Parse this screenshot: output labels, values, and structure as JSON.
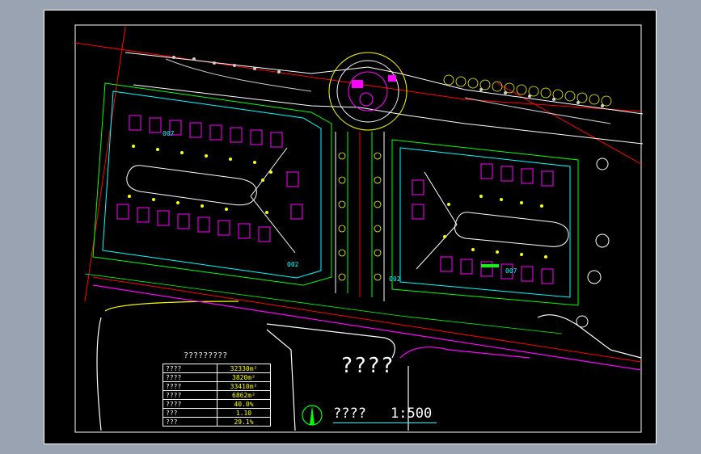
{
  "app": {
    "background": "#9aa3b1",
    "canvas_color": "#000000"
  },
  "table": {
    "title": "?????????",
    "rows": [
      {
        "key": "????",
        "value": "32330m²"
      },
      {
        "key": "????",
        "value": "3820m²"
      },
      {
        "key": "????",
        "value": "33410m²"
      },
      {
        "key": "????",
        "value": "6862m²"
      },
      {
        "key": "????",
        "value": "40.0%"
      },
      {
        "key": "???",
        "value": "1.10"
      },
      {
        "key": "???",
        "value": "29.1%"
      }
    ]
  },
  "plaza_label": "????",
  "plan_title": "????",
  "plan_scale": "1:500",
  "lot_labels": [
    "007",
    "002",
    "007",
    "002"
  ],
  "colors": {
    "roads": "#ffffff",
    "boundary": "#ff0000",
    "buildings": "#ff00ff",
    "green": "#00ff00",
    "trees": "#ffff00",
    "lots": "#00ffff"
  }
}
